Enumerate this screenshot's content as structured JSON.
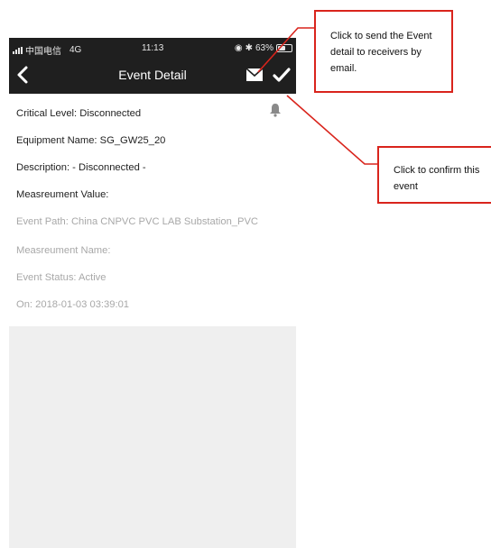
{
  "status_bar": {
    "carrier": "中国电信",
    "network": "4G",
    "time": "11:13",
    "battery": "63%",
    "battery_level": 0.63
  },
  "navbar": {
    "title": "Event Detail",
    "back_icon": "chevron-left-icon",
    "email_icon": "envelope-icon",
    "confirm_icon": "checkmark-icon"
  },
  "bell_icon": "bell-icon",
  "details": {
    "critical_level": "Critical Level: Disconnected",
    "equipment_name": "Equipment Name: SG_GW25_20",
    "description": "Description: - Disconnected -",
    "measurement_value": "Measreument Value:",
    "event_path": "Event Path: China CNPVC PVC LAB Substation_PVC",
    "measurement_name": "Measreument Name:",
    "event_status": "Event Status: Active",
    "on": "On: 2018-01-03 03:39:01"
  },
  "callouts": {
    "email": "Click to send the Event detail to receivers by email.",
    "confirm": "Click to confirm this event"
  },
  "colors": {
    "callout_border": "#d9241c",
    "navbar_bg": "#1f1f1f",
    "panel_bg": "#efefef"
  }
}
